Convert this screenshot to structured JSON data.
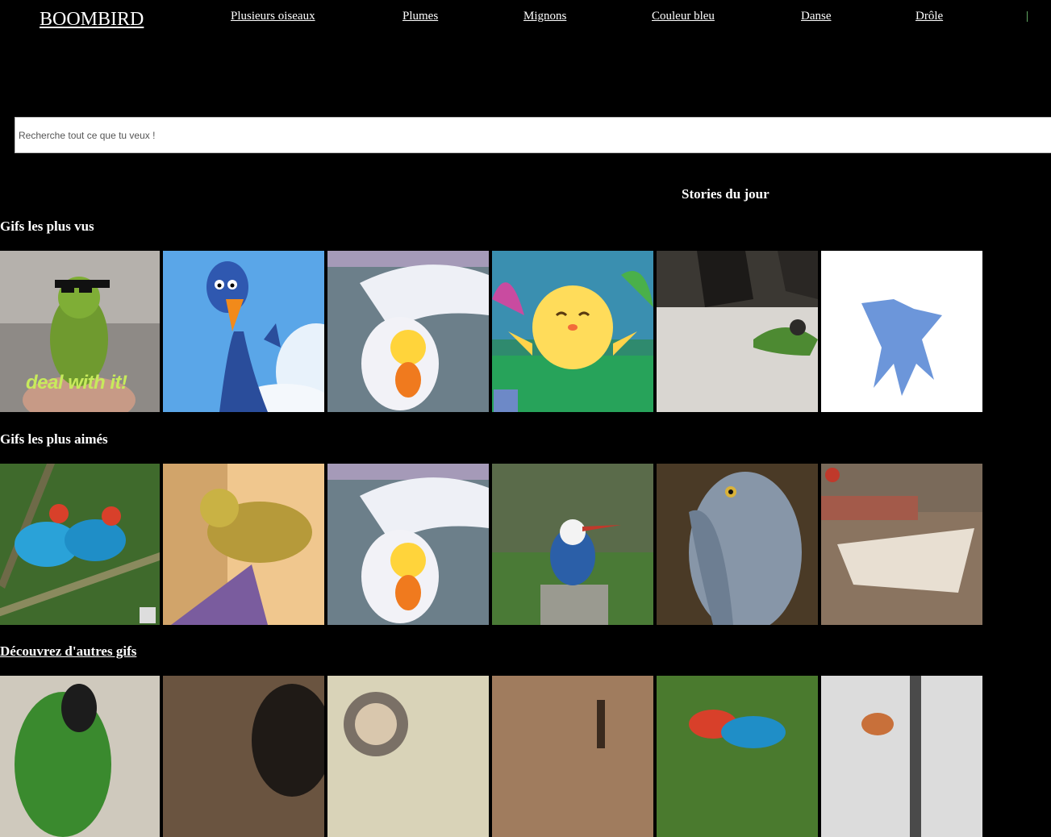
{
  "header": {
    "logo": "BOOMBIRD",
    "nav": [
      "Plusieurs oiseaux",
      "Plumes",
      "Mignons",
      "Couleur bleu",
      "Danse",
      "Drôle"
    ],
    "separator": "|"
  },
  "search": {
    "placeholder": "Recherche tout ce que tu veux !",
    "value": ""
  },
  "stories_title": "Stories du jour",
  "sections": {
    "most_viewed": {
      "title": "Gifs les plus vus",
      "items": [
        {
          "subject": "green parakeet wearing pixel sunglasses",
          "caption": "deal with it!"
        },
        {
          "subject": "cartoon blue bird with orange beak",
          "caption": ""
        },
        {
          "subject": "cartoon yellow chick held in white glove",
          "caption": ""
        },
        {
          "subject": "cartoon yellow chick dancing",
          "caption": ""
        },
        {
          "subject": "green lovebird next to feet",
          "caption": ""
        },
        {
          "subject": "blue watercolor bird silhouette",
          "caption": ""
        }
      ]
    },
    "most_liked": {
      "title": "Gifs les plus aimés",
      "items": [
        {
          "subject": "blue manakins on branch"
        },
        {
          "subject": "yellow budgie on phone"
        },
        {
          "subject": "cartoon yellow chick held in white glove"
        },
        {
          "subject": "kingfisher on post"
        },
        {
          "subject": "shoebill stork close-up"
        },
        {
          "subject": "birds on zoo table"
        }
      ]
    },
    "discover": {
      "title": "Découvrez d'autres gifs",
      "items": [
        {
          "subject": "green parrot"
        },
        {
          "subject": "bird in dark room"
        },
        {
          "subject": "person with bird"
        },
        {
          "subject": "brown bird close-up"
        },
        {
          "subject": "manakins on branch"
        },
        {
          "subject": "bird on fence"
        }
      ]
    }
  },
  "colors": {
    "background": "#000000",
    "text": "#ffffff",
    "separator": "#7fd97f"
  }
}
